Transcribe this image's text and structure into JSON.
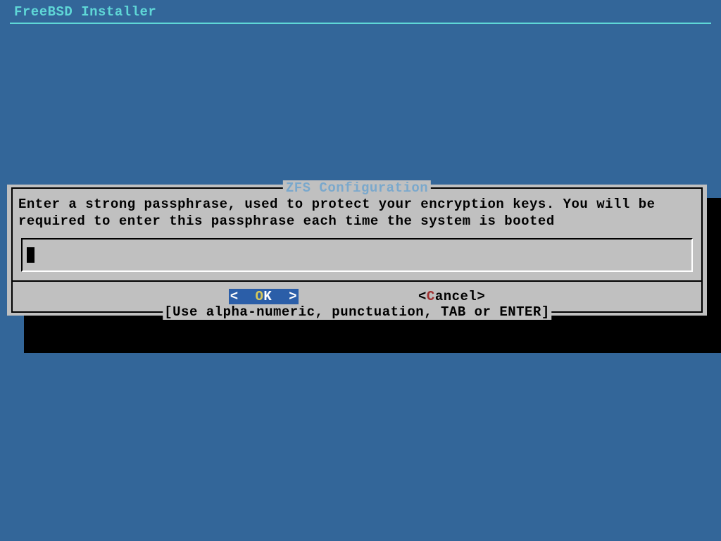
{
  "header": {
    "title": "FreeBSD Installer"
  },
  "dialog": {
    "title": "ZFS Configuration",
    "message": "Enter a strong passphrase, used to protect your encryption keys. You will be\nrequired to enter this passphrase each time the system is booted",
    "input_value": "",
    "buttons": {
      "ok": {
        "left": "<  ",
        "hot": "O",
        "rest": "K  >"
      },
      "cancel": {
        "left": "<",
        "hot": "C",
        "rest": "ancel>"
      }
    },
    "hint": "[Use alpha-numeric, punctuation, TAB or ENTER]"
  }
}
